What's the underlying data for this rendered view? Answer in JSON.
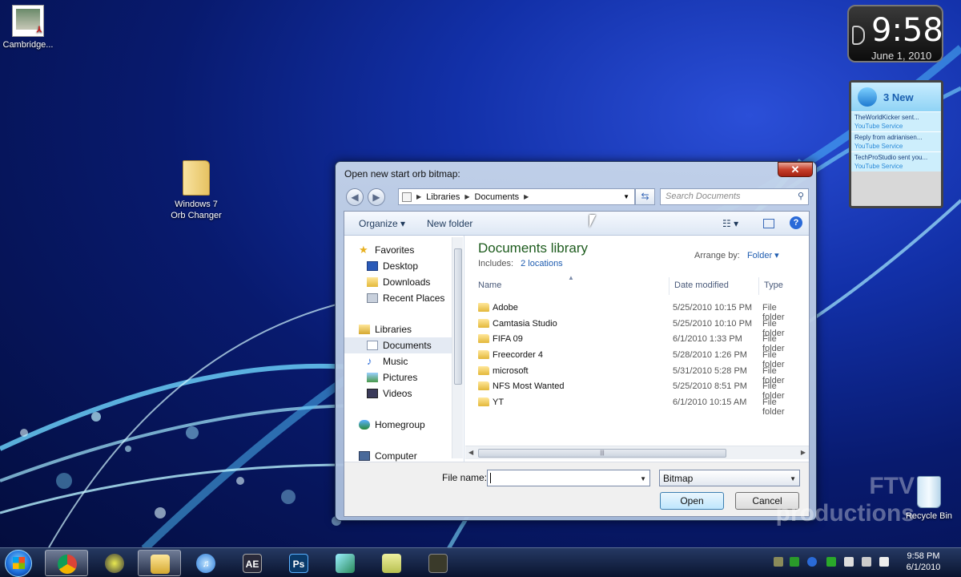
{
  "desktop": {
    "icons": [
      {
        "label": "Cambridge..."
      },
      {
        "label": "Windows 7\nOrb Changer"
      },
      {
        "label": "Recycle Bin"
      }
    ],
    "watermark": "FTV\nproductions"
  },
  "clock_gadget": {
    "time": "9:58",
    "date": "June 1, 2010"
  },
  "feed_gadget": {
    "header": "3 New",
    "items": [
      {
        "title": "TheWorldKicker sent...",
        "source": "YouTube Service"
      },
      {
        "title": "Reply from adrianisen...",
        "source": "YouTube Service"
      },
      {
        "title": "TechProStudio sent you...",
        "source": "YouTube Service"
      }
    ]
  },
  "dialog": {
    "title": "Open new start orb bitmap:",
    "close_label": "✕",
    "address": {
      "segments": [
        "Libraries",
        "Documents"
      ]
    },
    "search_placeholder": "Search Documents",
    "toolbar": {
      "organize": "Organize ▾",
      "new_folder": "New folder"
    },
    "nav": {
      "favorites": "Favorites",
      "desktop": "Desktop",
      "downloads": "Downloads",
      "recent": "Recent Places",
      "libraries": "Libraries",
      "documents": "Documents",
      "music": "Music",
      "pictures": "Pictures",
      "videos": "Videos",
      "homegroup": "Homegroup",
      "computer": "Computer"
    },
    "library": {
      "title": "Documents library",
      "includes_label": "Includes:",
      "locations": "2 locations",
      "arrange_label": "Arrange by:",
      "arrange_value": "Folder ▾"
    },
    "columns": {
      "name": "Name",
      "date": "Date modified",
      "type": "Type"
    },
    "files": [
      {
        "name": "Adobe",
        "date": "5/25/2010 10:15 PM",
        "type": "File folder"
      },
      {
        "name": "Camtasia Studio",
        "date": "5/25/2010 10:10 PM",
        "type": "File folder"
      },
      {
        "name": "FIFA 09",
        "date": "6/1/2010 1:33 PM",
        "type": "File folder"
      },
      {
        "name": "Freecorder 4",
        "date": "5/28/2010 1:26 PM",
        "type": "File folder"
      },
      {
        "name": "microsoft",
        "date": "5/31/2010 5:28 PM",
        "type": "File folder"
      },
      {
        "name": "NFS Most Wanted",
        "date": "5/25/2010 8:51 PM",
        "type": "File folder"
      },
      {
        "name": "YT",
        "date": "6/1/2010 10:15 AM",
        "type": "File folder"
      }
    ],
    "file_name_label": "File name:",
    "file_name_value": "",
    "file_type": "Bitmap",
    "open_label": "Open",
    "cancel_label": "Cancel"
  },
  "taskbar": {
    "time": "9:58 PM",
    "date": "6/1/2010",
    "apps": [
      {
        "name": "Windows Explorer"
      },
      {
        "name": "Google Chrome"
      },
      {
        "name": "Media"
      },
      {
        "name": "Folder"
      },
      {
        "name": "iTunes",
        "label": "♫"
      },
      {
        "name": "After Effects",
        "label": "AE"
      },
      {
        "name": "Photoshop",
        "label": "Ps"
      },
      {
        "name": "Tool"
      },
      {
        "name": "Notes"
      },
      {
        "name": "Camera"
      }
    ]
  }
}
